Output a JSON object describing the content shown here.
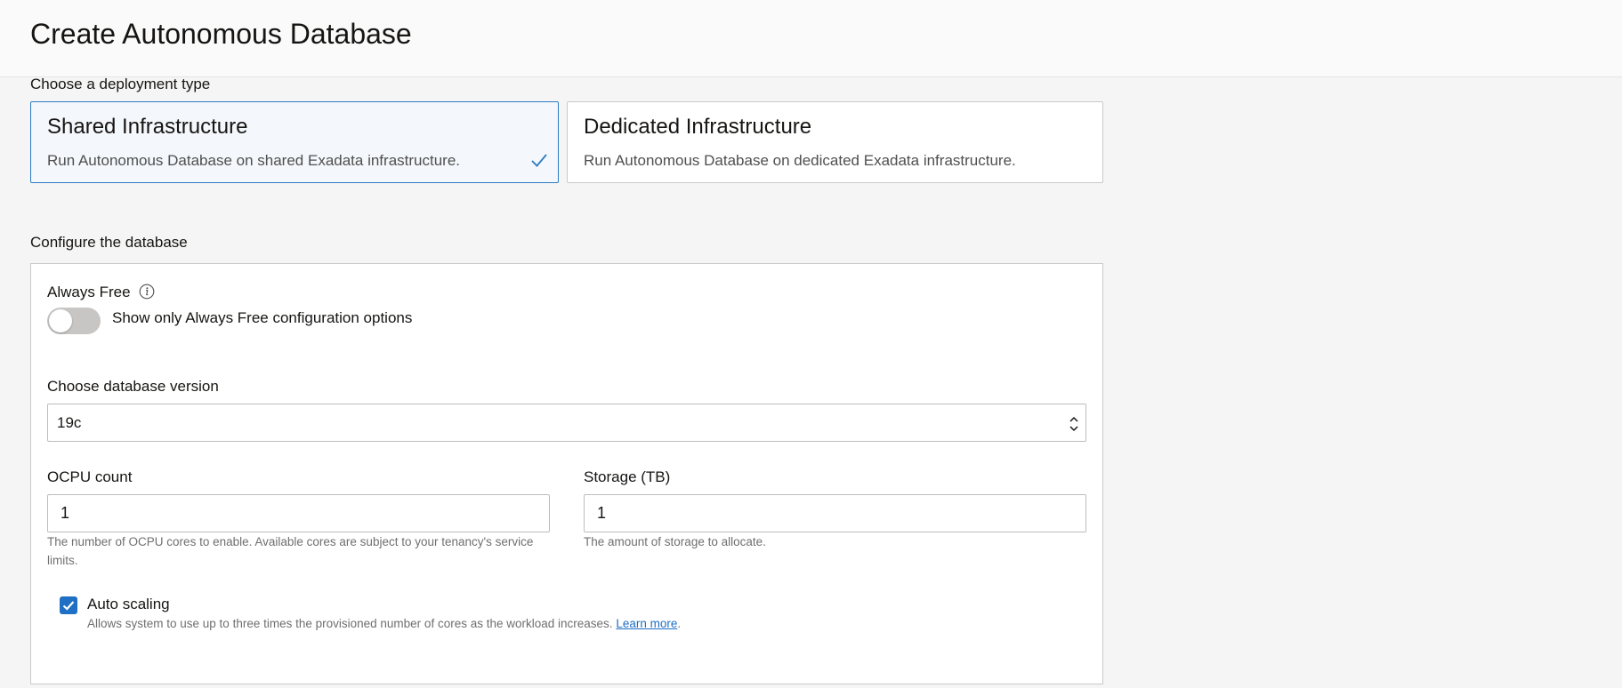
{
  "page": {
    "title": "Create Autonomous Database"
  },
  "deployment": {
    "section_label": "Choose a deployment type",
    "cards": [
      {
        "title": "Shared Infrastructure",
        "description": "Run Autonomous Database on shared Exadata infrastructure.",
        "selected": true
      },
      {
        "title": "Dedicated Infrastructure",
        "description": "Run Autonomous Database on dedicated Exadata infrastructure.",
        "selected": false
      }
    ]
  },
  "configure": {
    "section_label": "Configure the database",
    "always_free": {
      "label": "Always Free",
      "toggle_label": "Show only Always Free configuration options",
      "enabled": false
    },
    "version": {
      "label": "Choose database version",
      "value": "19c"
    },
    "ocpu": {
      "label": "OCPU count",
      "value": "1",
      "help": "The number of OCPU cores to enable. Available cores are subject to your tenancy's service limits."
    },
    "storage": {
      "label": "Storage (TB)",
      "value": "1",
      "help": "The amount of storage to allocate."
    },
    "auto_scaling": {
      "label": "Auto scaling",
      "checked": true,
      "help": "Allows system to use up to three times the provisioned number of cores as the workload increases.",
      "link_text": "Learn more"
    }
  },
  "colors": {
    "accent": "#1f6fc5",
    "selected_border": "#2d7bc3",
    "selected_bg": "#f4f7fb",
    "page_bg": "#f5f5f5"
  }
}
